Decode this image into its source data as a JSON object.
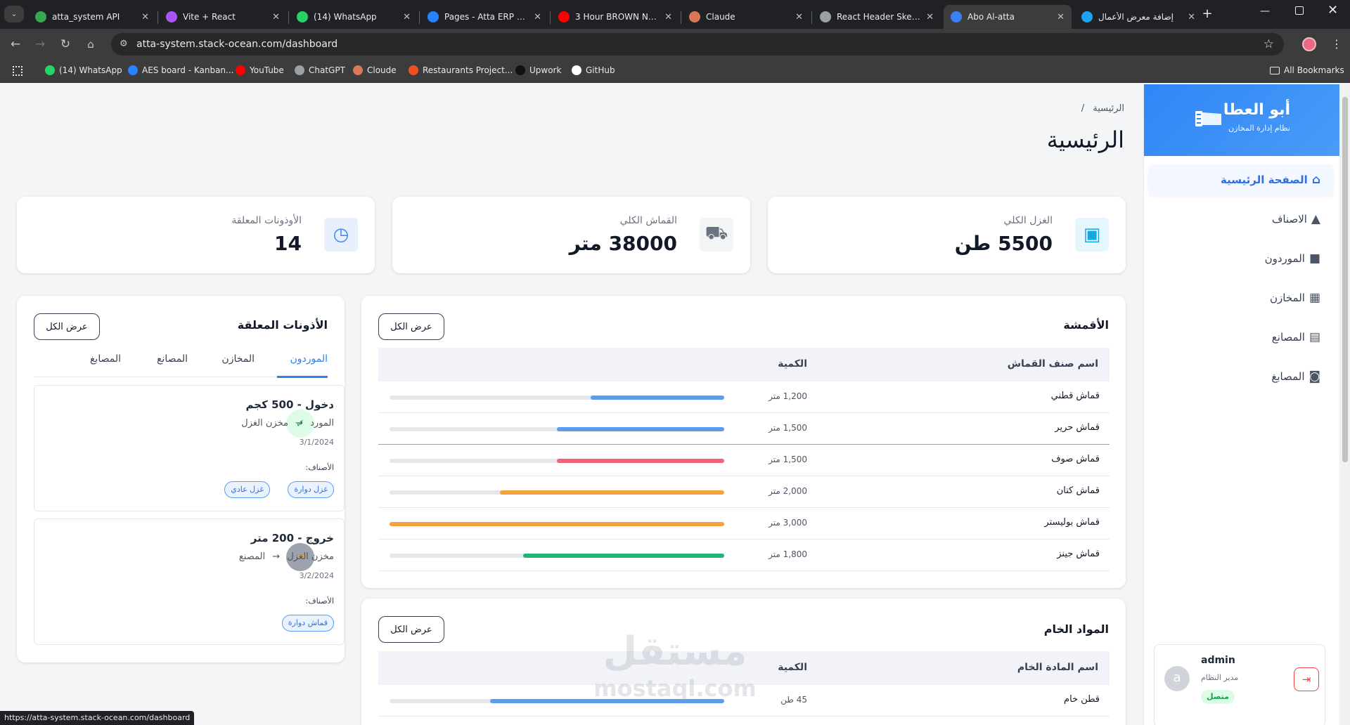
{
  "browser": {
    "tabs": [
      {
        "title": "atta_system API",
        "active": false,
        "icon": "green-circle-icon",
        "color": "#34a853"
      },
      {
        "title": "Vite + React",
        "active": false,
        "icon": "vite-icon",
        "color": "#a855f7"
      },
      {
        "title": "(14) WhatsApp",
        "active": false,
        "icon": "whatsapp-icon",
        "color": "#25d366"
      },
      {
        "title": "Pages - Atta ERP syst",
        "active": false,
        "icon": "jira-icon",
        "color": "#2684ff"
      },
      {
        "title": "3 Hour BROWN NOIS",
        "active": false,
        "icon": "youtube-icon",
        "color": "#ff0000"
      },
      {
        "title": "Claude",
        "active": false,
        "icon": "claude-icon",
        "color": "#d97757"
      },
      {
        "title": "React Header Skeleto",
        "active": false,
        "icon": "chatgpt-icon",
        "color": "#9aa0a6"
      },
      {
        "title": "Abo Al-atta",
        "active": true,
        "icon": "app-icon",
        "color": "#3b82f6"
      },
      {
        "title": "إضافة معرض الأعمال",
        "active": false,
        "icon": "mostaql-icon",
        "color": "#1da1f2"
      }
    ],
    "url": "atta-system.stack-ocean.com/dashboard",
    "bookmarks": [
      {
        "label": "(14) WhatsApp",
        "color": "#25d366"
      },
      {
        "label": "AES board - Kanban...",
        "color": "#2684ff"
      },
      {
        "label": "YouTube",
        "color": "#ff0000"
      },
      {
        "label": "ChatGPT",
        "color": "#9aa0a6"
      },
      {
        "label": "Cloude",
        "color": "#d97757"
      },
      {
        "label": "Restaurants Project...",
        "color": "#f24e1e"
      },
      {
        "label": "Upwork",
        "color": "#111111"
      },
      {
        "label": "GitHub",
        "color": "#ffffff"
      }
    ],
    "all_bookmarks": "All Bookmarks",
    "status_url": "https://atta-system.stack-ocean.com/dashboard"
  },
  "sidebar": {
    "brand_title": "أبو العطا",
    "brand_subtitle": "نظام إدارة المخازن",
    "items": [
      {
        "label": "الصفحة الرئيسية",
        "icon": "home-icon",
        "active": true
      },
      {
        "label": "الاصناف",
        "icon": "shapes-icon",
        "active": false
      },
      {
        "label": "الموردون",
        "icon": "truck-icon",
        "active": false
      },
      {
        "label": "المخازن",
        "icon": "warehouse-icon",
        "active": false
      },
      {
        "label": "المصانع",
        "icon": "factory-icon",
        "active": false
      },
      {
        "label": "المصابغ",
        "icon": "washer-icon",
        "active": false
      }
    ],
    "user": {
      "name": "admin",
      "role": "مدير النظام",
      "status": "متصل",
      "avatar_letter": "a"
    }
  },
  "page": {
    "breadcrumb": "الرئيسية",
    "breadcrumb_sep": "/",
    "title": "الرئيسية"
  },
  "stats": [
    {
      "label": "الغزل الكلي",
      "value": "5500 طن",
      "icon": "archive-icon",
      "color": "#12a9e0"
    },
    {
      "label": "القماش الكلي",
      "value": "38000 متر",
      "icon": "cart-icon",
      "color": "#6b7280"
    },
    {
      "label": "الأوذونات المعلقة",
      "value": "14",
      "icon": "clipboard-clock-icon",
      "color": "#3b82f6"
    }
  ],
  "fabrics": {
    "title": "الأقمشة",
    "view_all": "عرض الكل",
    "col_name": "اسم صنف القماش",
    "col_qty": "الكمية",
    "rows": [
      {
        "name": "قماش قطني",
        "qty": "1,200 متر",
        "pct": 40,
        "color": "#5b9cf0"
      },
      {
        "name": "قماش حرير",
        "qty": "1,500 متر",
        "pct": 50,
        "color": "#5b9cf0"
      },
      {
        "name": "قماش صوف",
        "qty": "1,500 متر",
        "pct": 50,
        "color": "#f0627a"
      },
      {
        "name": "قماش كتان",
        "qty": "2,000 متر",
        "pct": 67,
        "color": "#f5a23a"
      },
      {
        "name": "قماش بوليستر",
        "qty": "3,000 متر",
        "pct": 100,
        "color": "#f5a23a"
      },
      {
        "name": "قماش جينز",
        "qty": "1,800 متر",
        "pct": 60,
        "color": "#1fb574"
      }
    ]
  },
  "raw": {
    "title": "المواد الخام",
    "view_all": "عرض الكل",
    "col_name": "اسم المادة الخام",
    "col_qty": "الكمية",
    "rows": [
      {
        "name": "قطن خام",
        "qty": "45 طن",
        "pct": 70,
        "color": "#5b9cf0"
      }
    ]
  },
  "permits": {
    "title": "الأذونات المعلقة",
    "view_all": "عرض الكل",
    "tabs": [
      "الموردون",
      "المخازن",
      "المصانع",
      "المصابغ"
    ],
    "items_label": "الأصناف:",
    "items": [
      {
        "title": "دخول - 500 كجم",
        "from": "المورد",
        "to": "مخزن الغزل",
        "date": "3/1/2024",
        "chips": [
          "غزل دوارة",
          "غزل عادي"
        ],
        "icon": "check-clipboard-icon",
        "icon_color": "#22c55e"
      },
      {
        "title": "خروج - 200 متر",
        "from": "مخزن الغزل",
        "to": "المصنع",
        "date": "3/2/2024",
        "chips": [
          "قماش دوارة"
        ],
        "icon": "exit-icon",
        "icon_color": "#f59e0b"
      }
    ]
  },
  "watermark": {
    "arabic": "مستقل",
    "latin": "mostaql.com"
  }
}
